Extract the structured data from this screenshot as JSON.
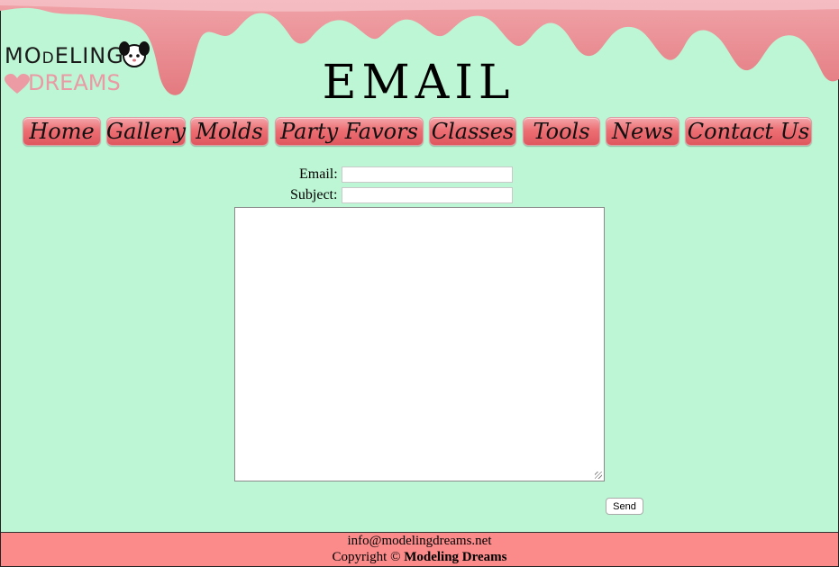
{
  "logo": {
    "line1": "MOdELING",
    "line2": "DREAMS"
  },
  "page_title": "EMAIL",
  "nav": [
    "Home",
    "Gallery",
    "Molds",
    "Party Favors",
    "Classes",
    "Tools",
    "News",
    "Contact Us"
  ],
  "form": {
    "email_label": "Email:",
    "subject_label": "Subject:",
    "email_value": "",
    "subject_value": "",
    "message_value": "",
    "send_label": "Send"
  },
  "footer": {
    "email": "info@modelingdreams.net",
    "copyright_prefix": "Copyright ©",
    "company": "Modeling Dreams"
  },
  "colors": {
    "background": "#bdf6d4",
    "drip": "#e8878b",
    "nav_button": "#ec6f74",
    "footer": "#fb8a8a"
  }
}
